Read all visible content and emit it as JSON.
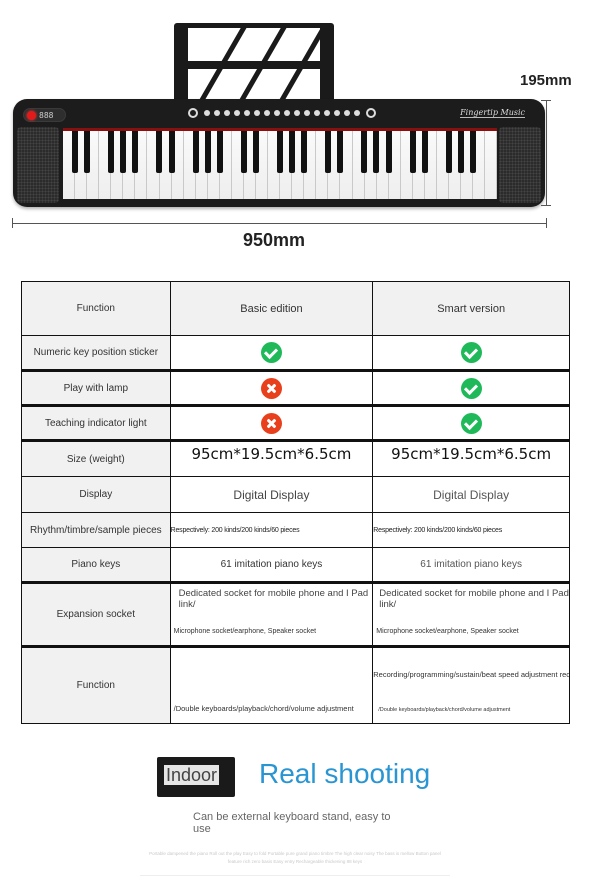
{
  "product": {
    "brand_label": "Fingertip Music",
    "display_readout": "888",
    "dimensions": {
      "height_label": "195mm",
      "width_label": "950mm"
    }
  },
  "comparison_table": {
    "headers": {
      "function": "Function",
      "basic": "Basic edition",
      "smart": "Smart version"
    },
    "rows": [
      {
        "feature": "Numeric key position sticker",
        "basic": "check",
        "smart": "check"
      },
      {
        "feature": "Play with lamp",
        "basic": "cross",
        "smart": "check"
      },
      {
        "feature": "Teaching indicator light",
        "basic": "cross",
        "smart": "check"
      },
      {
        "feature": "Size (weight)",
        "basic": "95cm*19.5cm*6.5cm",
        "smart": "95cm*19.5cm*6.5cm"
      },
      {
        "feature": "Display",
        "basic": "Digital Display",
        "smart": "Digital Display"
      },
      {
        "feature": "Rhythm/timbre/sample pieces",
        "basic": "Respectively: 200 kinds/200 kinds/60 pieces",
        "smart": "Respectively: 200 kinds/200 kinds/60 pieces"
      },
      {
        "feature": "Piano keys",
        "basic": "61 imitation piano keys",
        "smart": "61 imitation piano keys"
      },
      {
        "feature": "Expansion socket",
        "basic": {
          "main": "Dedicated socket for mobile phone and I Pad link/",
          "sub": "Microphone socket/earphone, Speaker socket"
        },
        "smart": {
          "main": "Dedicated socket for mobile phone and I Pad link/",
          "sub": "Microphone socket/earphone, Speaker socket"
        }
      },
      {
        "feature": "Function",
        "basic": {
          "top": "",
          "bottom": "/Double keyboards/playback/chord/volume adjustment"
        },
        "smart": {
          "top": "Recording/programming/sustain/beat speed adjustment rec",
          "bottom": "/Double keyboards/playback/chord/volume adjustment"
        }
      }
    ],
    "icon_colors": {
      "check": "#20b95a",
      "cross": "#e8401c"
    }
  },
  "footer": {
    "indoor_label": "Indoor",
    "title": "Real shooting",
    "title_color": "#2a95d3",
    "caption": "Can be external keyboard stand, easy to use",
    "fine_print": "Portable dampened the piano Roll out the play Easy to fold Portable pure grand piano timbre The high clear noisy The bass is mellow Button panel feature rich zero basis Easy entry Rechargeable thickening 88 keys"
  }
}
